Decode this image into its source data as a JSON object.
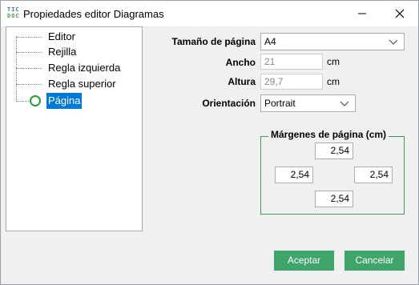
{
  "window": {
    "title": "Propiedades editor Diagramas",
    "app_icon_text": [
      "TIC",
      "DOC"
    ]
  },
  "tree": {
    "items": [
      {
        "label": "Editor",
        "selected": false
      },
      {
        "label": "Rejilla",
        "selected": false
      },
      {
        "label": "Regla izquierda",
        "selected": false
      },
      {
        "label": "Regla superior",
        "selected": false
      },
      {
        "label": "Página",
        "selected": true
      }
    ]
  },
  "form": {
    "page_size_label": "Tamaño de página",
    "page_size_value": "A4",
    "width_label": "Ancho",
    "width_value": "21",
    "height_label": "Altura",
    "height_value": "29,7",
    "unit": "cm",
    "orientation_label": "Orientación",
    "orientation_value": "Portrait"
  },
  "margins": {
    "title": "Márgenes de página  (cm)",
    "top": "2,54",
    "left": "2,54",
    "right": "2,54",
    "bottom": "2,54"
  },
  "buttons": {
    "accept": "Aceptar",
    "cancel": "Cancelar"
  },
  "colors": {
    "accent_green": "#3ea46a",
    "selection_blue": "#0078d7",
    "group_border": "#3f9b5a"
  }
}
